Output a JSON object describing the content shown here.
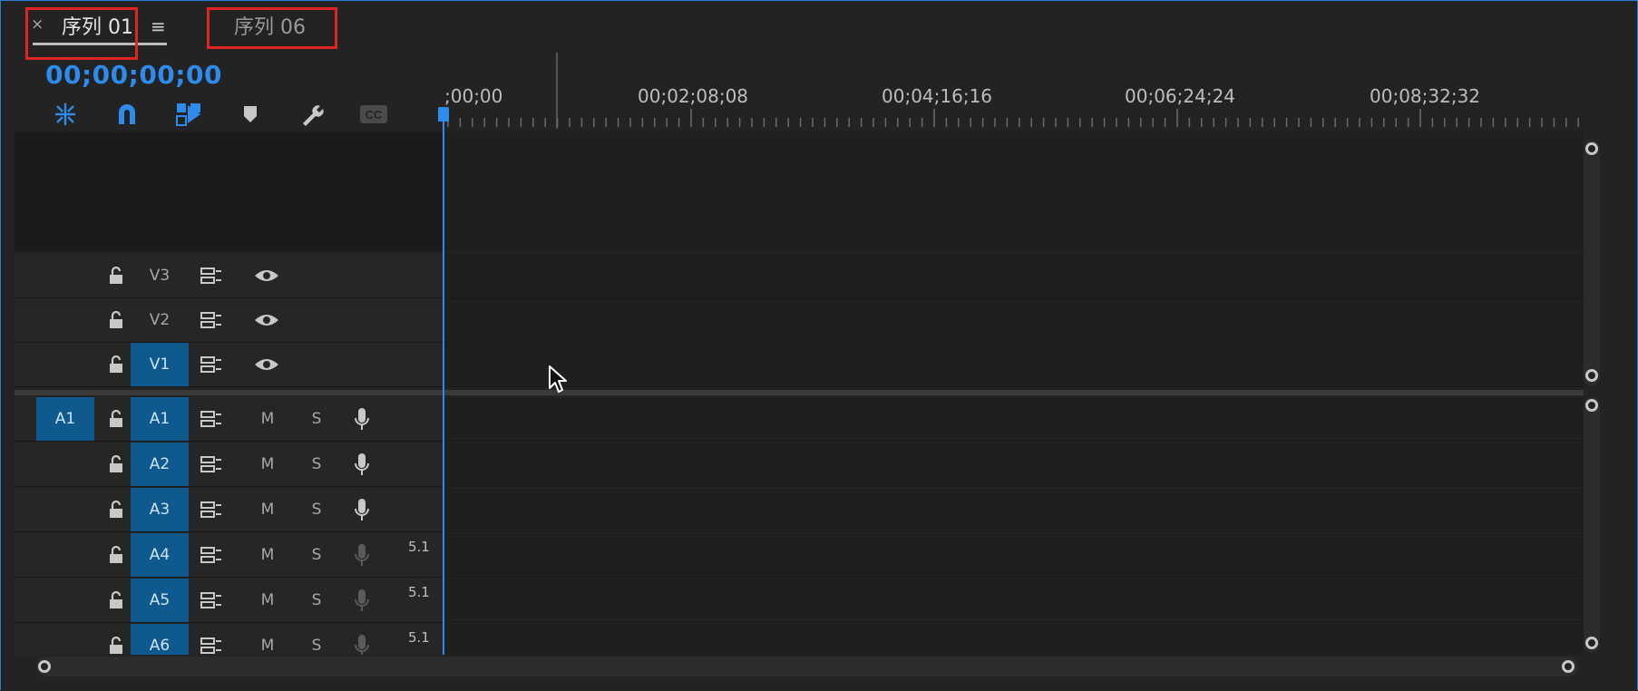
{
  "tabs": {
    "close_symbol": "×",
    "active_label": "序列 01",
    "menu_symbol": "≡",
    "inactive_label": "序列 06"
  },
  "timecode": "00;00;00;00",
  "toolbar": {
    "icons": [
      "insert-overwrite-icon",
      "snap-magnet-icon",
      "linked-selection-icon",
      "add-marker-icon",
      "wrench-settings-icon",
      "captions-cc-icon"
    ],
    "cc_text": "CC"
  },
  "ruler": {
    "labels": [
      ";00;00",
      "00;02;08;08",
      "00;04;16;16",
      "00;06;24;24",
      "00;08;32;32"
    ]
  },
  "video_tracks": [
    {
      "name": "V3",
      "targeted": false
    },
    {
      "name": "V2",
      "targeted": false
    },
    {
      "name": "V1",
      "targeted": true
    }
  ],
  "audio_tracks": [
    {
      "source": "A1",
      "name": "A1",
      "mute": "M",
      "solo": "S",
      "channel": ""
    },
    {
      "source": "",
      "name": "A2",
      "mute": "M",
      "solo": "S",
      "channel": ""
    },
    {
      "source": "",
      "name": "A3",
      "mute": "M",
      "solo": "S",
      "channel": ""
    },
    {
      "source": "",
      "name": "A4",
      "mute": "M",
      "solo": "S",
      "channel": "5.1"
    },
    {
      "source": "",
      "name": "A5",
      "mute": "M",
      "solo": "S",
      "channel": "5.1"
    },
    {
      "source": "",
      "name": "A6",
      "mute": "M",
      "solo": "S",
      "channel": "5.1"
    }
  ],
  "colors": {
    "accent": "#2d8ceb",
    "track_target": "#0e5a8e",
    "highlight": "#e02424"
  }
}
